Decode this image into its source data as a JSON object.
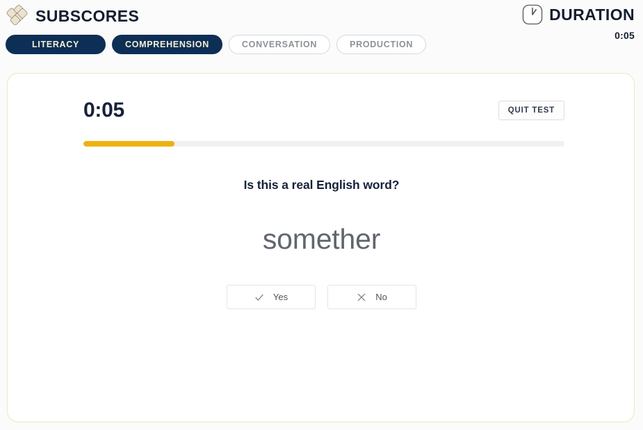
{
  "header": {
    "brand": {
      "logo_icon": "diamond-cluster-logo-icon",
      "title": "SUBSCORES"
    },
    "duration": {
      "icon": "clock-icon",
      "label": "DURATION",
      "value": "0:05"
    }
  },
  "tabs": [
    {
      "label": "LITERACY",
      "state": "active"
    },
    {
      "label": "COMPREHENSION",
      "state": "active"
    },
    {
      "label": "CONVERSATION",
      "state": "inactive"
    },
    {
      "label": "PRODUCTION",
      "state": "inactive"
    }
  ],
  "card": {
    "timer": "0:05",
    "quit_label": "QUIT TEST",
    "progress": {
      "percent": 19,
      "fill_color": "#eeb111",
      "track_color": "#f1f1f1"
    },
    "question_prompt": "Is this a real English word?",
    "stimulus_word": "somether",
    "answers": [
      {
        "label": "Yes",
        "icon": "check-icon"
      },
      {
        "label": "No",
        "icon": "cross-icon"
      }
    ]
  },
  "colors": {
    "navy": "#0e2f55",
    "accent_yellow": "#eeb111",
    "card_border": "#efe6bd",
    "text_dark": "#17213a",
    "text_muted": "#8c9196"
  }
}
